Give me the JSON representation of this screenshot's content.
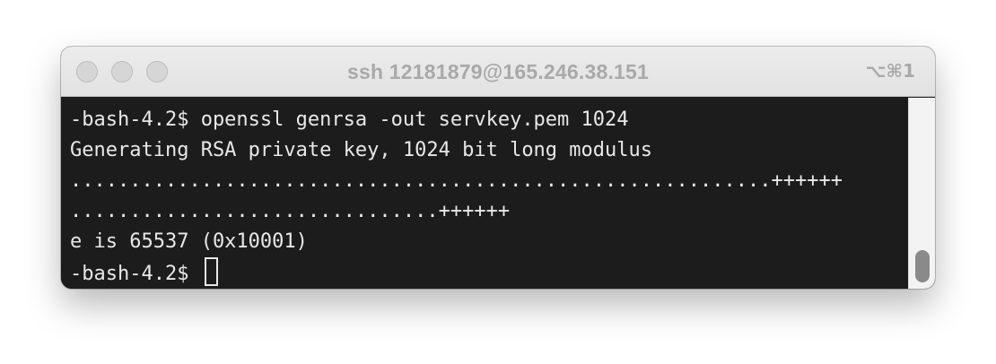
{
  "window": {
    "title": "ssh 12181879@165.246.38.151",
    "shortcut": "⌥⌘1"
  },
  "terminal": {
    "lines": [
      "-bash-4.2$ openssl genrsa -out servkey.pem 1024",
      "Generating RSA private key, 1024 bit long modulus",
      "...........................................................++++++",
      "...............................++++++",
      "e is 65537 (0x10001)"
    ],
    "prompt": "-bash-4.2$ "
  },
  "scrollbar": {
    "position_fraction": 1.0
  },
  "colors": {
    "terminal_background": "#1c1c1c",
    "terminal_text": "#e8e8e8",
    "titlebar": "#e6e6e6",
    "title_text": "#a9a9a9"
  }
}
